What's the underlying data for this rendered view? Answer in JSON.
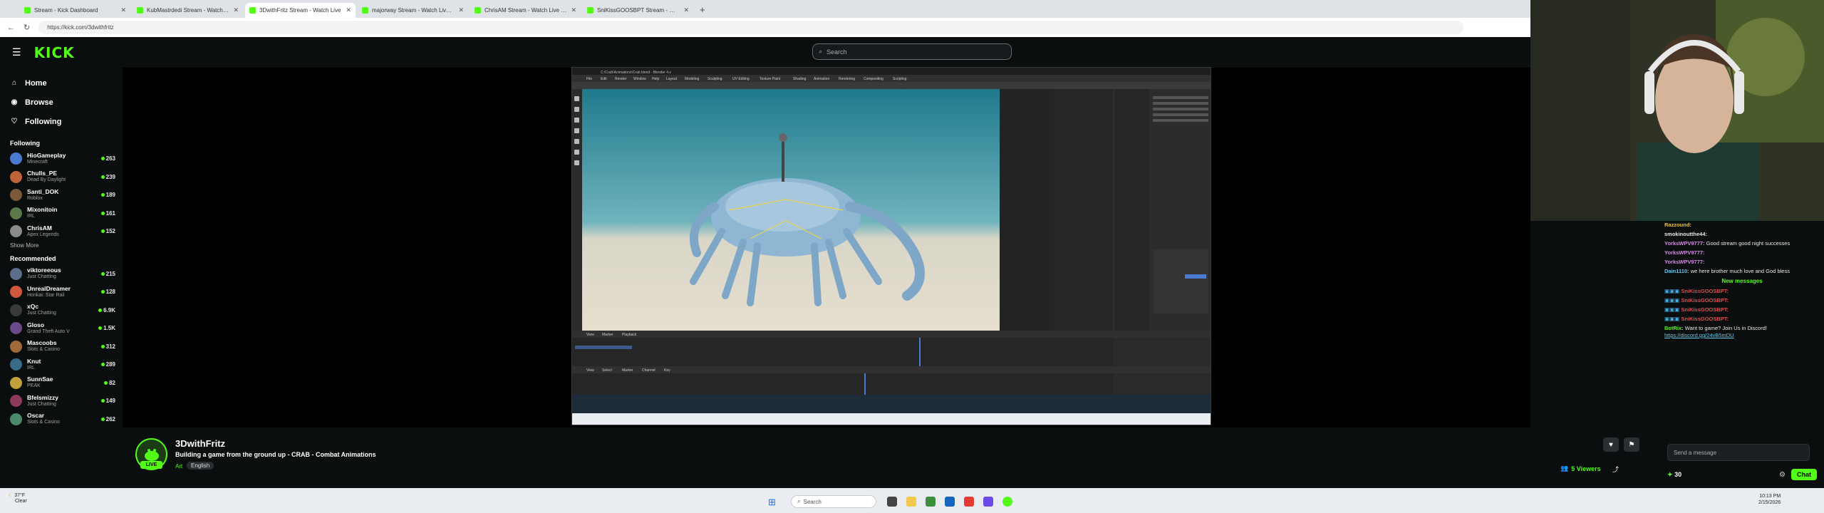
{
  "browser": {
    "tabs": [
      {
        "label": "Stream - Kick Dashboard",
        "active": false
      },
      {
        "label": "KubMastrdedi Stream - Watch Live",
        "active": false
      },
      {
        "label": "3DwithFritz Stream - Watch Live",
        "active": true
      },
      {
        "label": "majorway Stream - Watch Live on Kick",
        "active": false
      },
      {
        "label": "ChrisAM Stream - Watch Live on Kick",
        "active": false
      },
      {
        "label": "SniKissGOOSBPT Stream - Watch Live",
        "active": false
      }
    ],
    "url": "https://kick.com/3dwithfritz"
  },
  "header": {
    "logo": "KICK",
    "search_placeholder": "Search"
  },
  "sidebar": {
    "nav": [
      {
        "label": "Home",
        "icon": "home-icon"
      },
      {
        "label": "Browse",
        "icon": "browse-icon"
      },
      {
        "label": "Following",
        "icon": "heart-icon"
      }
    ],
    "following_title": "Following",
    "following": [
      {
        "name": "HioGameplay",
        "game": "Minecraft",
        "viewers": "263",
        "color": "#4a7bd0"
      },
      {
        "name": "Chulls_PE",
        "game": "Dead By Daylight",
        "viewers": "239",
        "color": "#c0633a"
      },
      {
        "name": "Santi_DOK",
        "game": "Roblox",
        "viewers": "189",
        "color": "#7a5a3a"
      },
      {
        "name": "Mixonitoin",
        "game": "IRL",
        "viewers": "161",
        "color": "#5a7a4a"
      },
      {
        "name": "ChrisAM",
        "game": "Apex Legends",
        "viewers": "152",
        "color": "#8a8a8a"
      }
    ],
    "show_more": "Show More",
    "recommended_title": "Recommended",
    "recommended": [
      {
        "name": "viktoreeous",
        "game": "Just Chatting",
        "viewers": "215",
        "color": "#5b6e8c"
      },
      {
        "name": "UnrealDreamer",
        "game": "Honkai: Star Rail",
        "viewers": "128",
        "color": "#d0583a"
      },
      {
        "name": "xQc",
        "game": "Just Chatting",
        "viewers": "6.9K",
        "color": "#3a3a3a"
      },
      {
        "name": "Gloso",
        "game": "Grand Theft Auto V",
        "viewers": "1.5K",
        "color": "#6a4a8a"
      },
      {
        "name": "Mascoobs",
        "game": "Slots & Casino",
        "viewers": "312",
        "color": "#a06a3a"
      },
      {
        "name": "Knut",
        "game": "IRL",
        "viewers": "289",
        "color": "#3a6a8a"
      },
      {
        "name": "SunnSae",
        "game": "PEAK",
        "viewers": "82",
        "color": "#c0a03a"
      },
      {
        "name": "Bfelsmizzy",
        "game": "Just Chatting",
        "viewers": "149",
        "color": "#8a3a5a"
      },
      {
        "name": "Oscar",
        "game": "Slots & Casino",
        "viewers": "262",
        "color": "#4a8a6a"
      }
    ]
  },
  "stream": {
    "streamer": "3DwithFritz",
    "live_tag": "LIVE",
    "title": "Building a game from the ground up - CRAB - Combat Animations",
    "category": "Art",
    "language_tag": "English",
    "viewers": "5 Viewers"
  },
  "blender": {
    "title": "C:\\Crab\\Animations\\Crab.blend - Blender 4.x",
    "menus": [
      "File",
      "Edit",
      "Render",
      "Window",
      "Help"
    ],
    "workspaces": [
      "Layout",
      "Modeling",
      "Sculpting",
      "UV Editing",
      "Texture Paint",
      "Shading",
      "Animation",
      "Rendering",
      "Compositing",
      "Scripting"
    ],
    "timeline_menus": [
      "View",
      "Marker",
      "Playback"
    ],
    "bottom_menus": [
      "View",
      "Select",
      "Marker",
      "Channel",
      "Key"
    ]
  },
  "chat": {
    "messages": [
      {
        "user": "Razzound:",
        "text": "",
        "color": "#e8c24a"
      },
      {
        "user": "smokinoutthe44:",
        "text": "",
        "color": "#e8e8e8"
      },
      {
        "user": "YorksWPV9777:",
        "text": "Good stream good night successes",
        "color": "#d88ae8"
      },
      {
        "user": "YorksWPV9777:",
        "text": "",
        "color": "#d88ae8"
      },
      {
        "user": "YorksWPV9777:",
        "text": "",
        "color": "#d88ae8"
      },
      {
        "user": "Dain1110:",
        "text": "we here brother much love and God bless",
        "color": "#6ac8e8"
      }
    ],
    "new_messages": "New messages",
    "spam": [
      {
        "user": "SniKissGOOSBPT:",
        "color": "#e84a4a"
      },
      {
        "user": "SniKissGOOSBPT:",
        "color": "#e84a4a"
      },
      {
        "user": "SniKissGOOSBPT:",
        "color": "#e84a4a"
      },
      {
        "user": "SniKissGOOSBPT:",
        "color": "#e84a4a"
      }
    ],
    "bot": {
      "user": "BotRix:",
      "text": "Want to game? Join Us in Discord!",
      "link": "https://discord.gg/24vB5mDU",
      "color": "#53fc18"
    },
    "input_placeholder": "Send a message",
    "points": "30",
    "send_label": "Chat"
  },
  "taskbar": {
    "weather_temp": "37°F",
    "weather_text": "Clear",
    "search": "Search",
    "time": "10:13 PM",
    "date": "2/15/2026"
  },
  "colors": {
    "accent": "#53fc18",
    "bg": "#0b0e0f"
  }
}
